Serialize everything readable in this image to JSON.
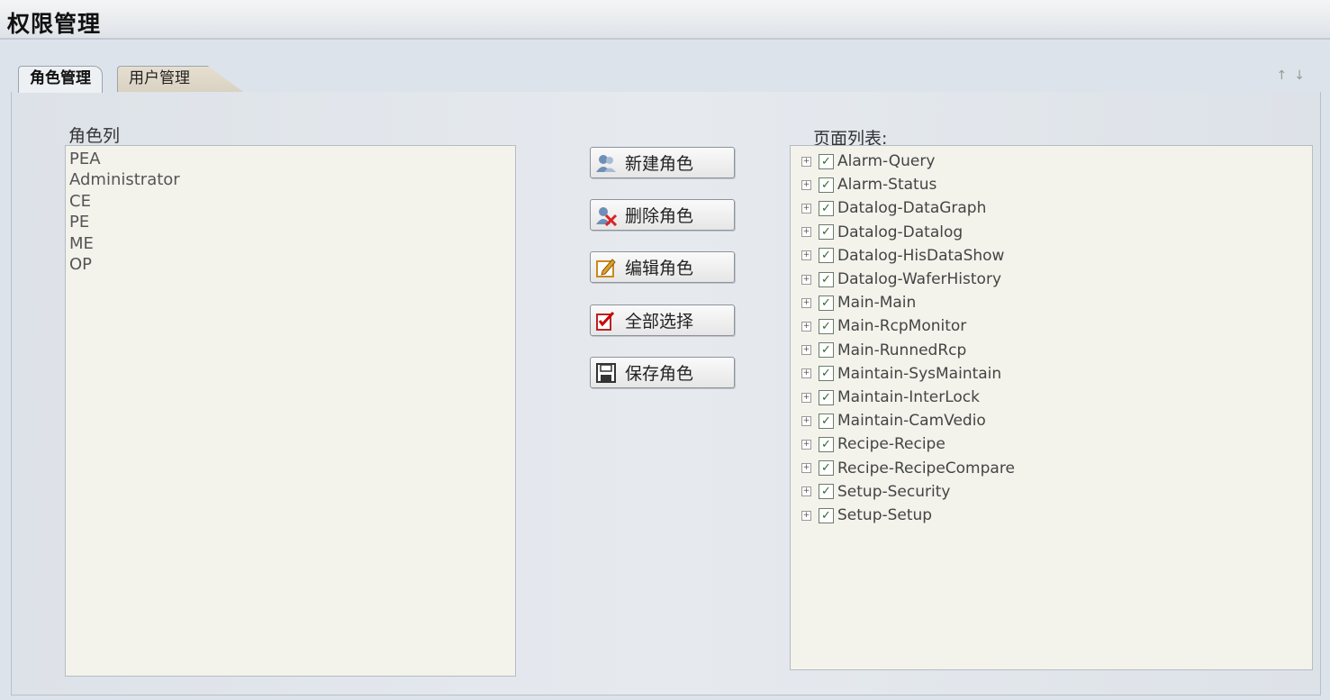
{
  "window": {
    "title": "权限管理"
  },
  "tabs": [
    {
      "label": "角色管理",
      "active": true
    },
    {
      "label": "用户管理",
      "active": false
    }
  ],
  "roles_panel": {
    "label": "角色列",
    "items": [
      "PEA",
      "Administrator",
      "CE",
      "PE",
      "ME",
      "OP"
    ]
  },
  "actions": {
    "new_role": "新建角色",
    "delete_role": "删除角色",
    "edit_role": "编辑角色",
    "select_all": "全部选择",
    "save_role": "保存角色"
  },
  "pages_panel": {
    "label": "页面列表:",
    "items": [
      {
        "name": "Alarm-Query",
        "checked": true
      },
      {
        "name": "Alarm-Status",
        "checked": true
      },
      {
        "name": "Datalog-DataGraph",
        "checked": true
      },
      {
        "name": "Datalog-Datalog",
        "checked": true
      },
      {
        "name": "Datalog-HisDataShow",
        "checked": true
      },
      {
        "name": "Datalog-WaferHistory",
        "checked": true
      },
      {
        "name": "Main-Main",
        "checked": true
      },
      {
        "name": "Main-RcpMonitor",
        "checked": true
      },
      {
        "name": "Main-RunnedRcp",
        "checked": true
      },
      {
        "name": "Maintain-SysMaintain",
        "checked": true
      },
      {
        "name": "Maintain-InterLock",
        "checked": true
      },
      {
        "name": "Maintain-CamVedio",
        "checked": true
      },
      {
        "name": "Recipe-Recipe",
        "checked": true
      },
      {
        "name": "Recipe-RecipeCompare",
        "checked": true
      },
      {
        "name": "Setup-Security",
        "checked": true
      },
      {
        "name": "Setup-Setup",
        "checked": true
      }
    ]
  },
  "icons": {
    "new_role": "users-icon",
    "delete_role": "delete-user-icon",
    "edit_role": "edit-icon",
    "select_all": "checklist-icon",
    "save_role": "save-icon",
    "expander": "expand-plus-icon",
    "checkbox": "checkmark-icon"
  }
}
